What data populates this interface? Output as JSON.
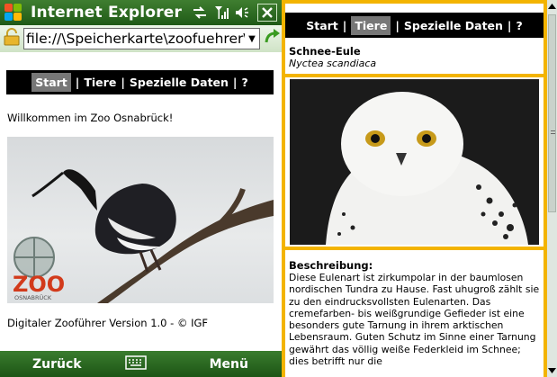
{
  "left": {
    "titlebar": {
      "title": "Internet Explorer"
    },
    "address": {
      "url": "file://\\Speicherkarte\\zoofuehrer\\i"
    },
    "nav": {
      "start": "Start",
      "tiere": "Tiere",
      "daten": "Spezielle Daten",
      "help": "?",
      "sep": "|"
    },
    "welcome": "Willkommen im Zoo Osnabrück!",
    "logo": {
      "word": "ZOO",
      "sub": "OSNABRÜCK"
    },
    "version": "Digitaler Zooführer Version 1.0 - © IGF",
    "softkeys": {
      "left": "Zurück",
      "right": "Menü"
    }
  },
  "right": {
    "nav": {
      "start": "Start",
      "tiere": "Tiere",
      "daten": "Spezielle Daten",
      "help": "?",
      "sep": "|"
    },
    "animal": {
      "name": "Schnee-Eule",
      "latin": "Nyctea scandiaca"
    },
    "description": {
      "label": "Beschreibung:",
      "text": "Diese Eulenart ist zirkumpolar in der baumlosen nordischen Tundra zu Hause. Fast uhugroß zählt sie zu den eindrucksvollsten Eulenarten. Das cremefarben- bis weißgrundige Gefieder ist eine besonders gute Tarnung in ihrem arktischen Lebensraum. Guten Schutz im Sinne einer Tarnung gewährt das völlig weiße Federkleid im Schnee; dies betrifft nur die"
    }
  },
  "colors": {
    "accent": "#f3b400",
    "titlebar": "#2d6a22",
    "nav_bg": "#000000",
    "nav_selected": "#777777"
  },
  "icons": [
    "windows-logo-icon",
    "connectivity-icon",
    "signal-icon",
    "volume-icon",
    "close-icon",
    "lock-icon",
    "go-arrow-icon",
    "keyboard-icon"
  ]
}
